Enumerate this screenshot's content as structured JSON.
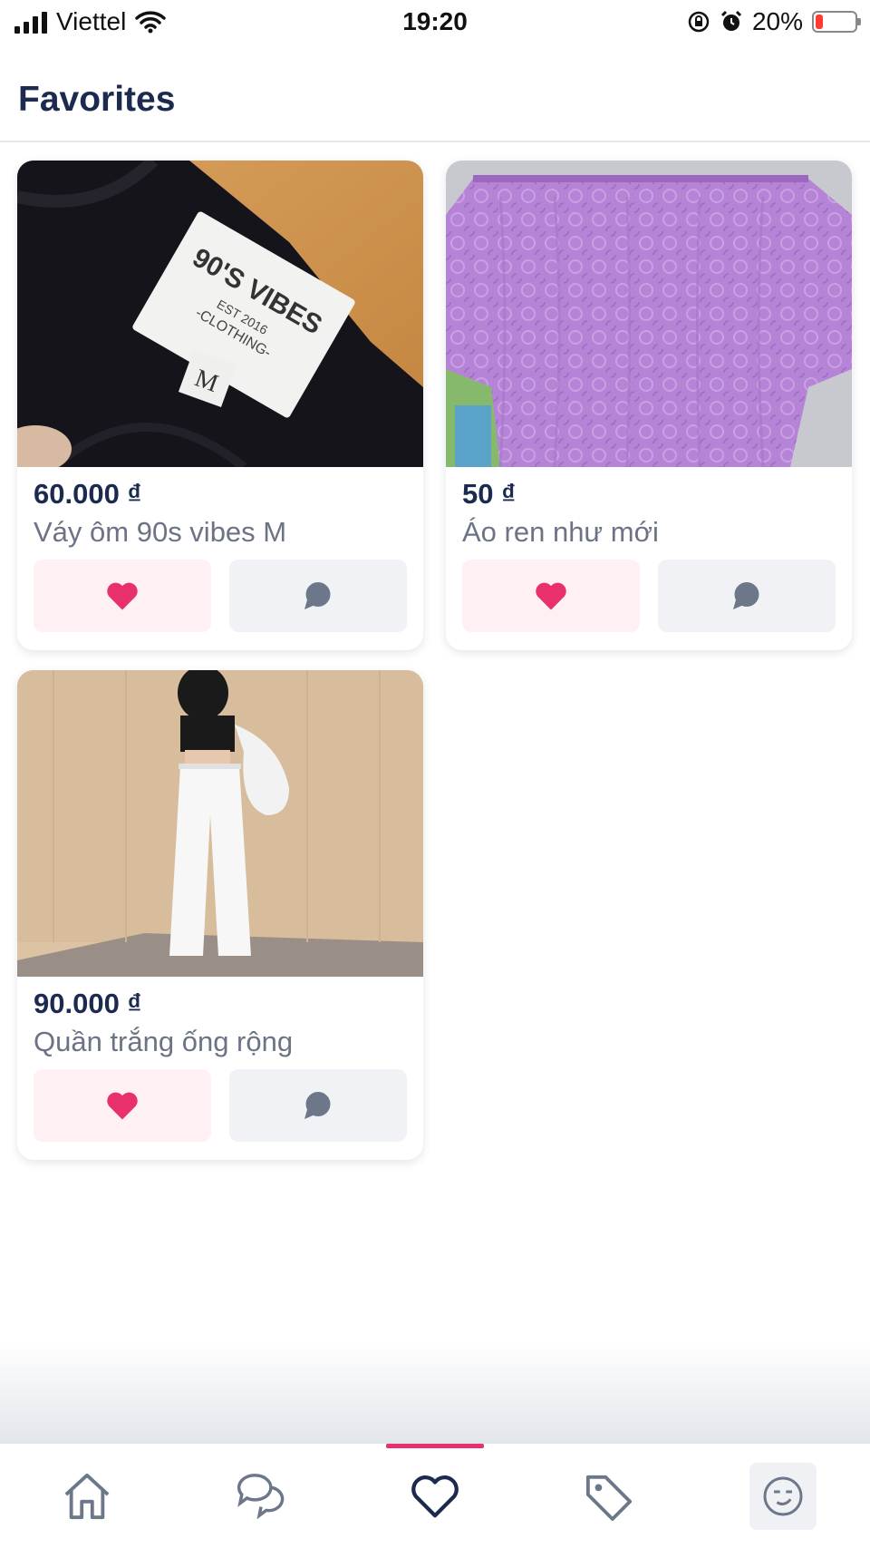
{
  "status_bar": {
    "carrier": "Viettel",
    "time": "19:20",
    "battery_percent": "20%",
    "battery_level": 0.2,
    "icons": [
      "signal-icon",
      "wifi-icon",
      "orientation-lock-icon",
      "alarm-icon",
      "battery-icon"
    ]
  },
  "header": {
    "title": "Favorites"
  },
  "products": [
    {
      "price": "60.000 ₫",
      "title": "Váy ôm 90s vibes M",
      "label_text": "90'S VIBES",
      "label_sub": "EST 2016",
      "label_sub2": "-CLOTHING-",
      "label_size": "M",
      "liked": true
    },
    {
      "price": "50 ₫",
      "title": "Áo ren như mới",
      "liked": true
    },
    {
      "price": "90.000 ₫",
      "title": "Quần trắng ống rộng",
      "liked": true
    }
  ],
  "colors": {
    "accent": "#e8316b",
    "title": "#1b2a4e",
    "muted_text": "#6b7385",
    "chat_icon": "#6c7789",
    "tab_icon": "#6c7789"
  },
  "tab_bar": {
    "active_index": 2,
    "tabs": [
      "home-icon",
      "messages-icon",
      "favorites-icon",
      "tag-icon",
      "profile-icon"
    ]
  }
}
